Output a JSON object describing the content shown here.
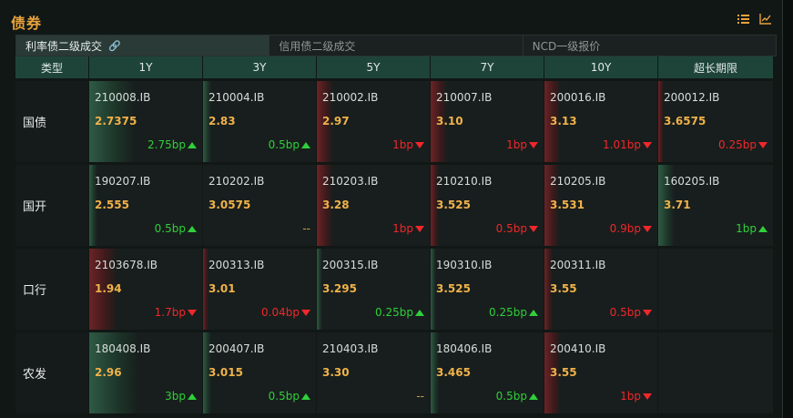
{
  "panel": {
    "title": "债券"
  },
  "tabs": [
    {
      "label": "利率债二级成交",
      "active": true
    },
    {
      "label": "信用债二级成交",
      "active": false
    },
    {
      "label": "NCD一级报价",
      "active": false
    }
  ],
  "table": {
    "corner": "类型",
    "columns": [
      "1Y",
      "3Y",
      "5Y",
      "7Y",
      "10Y",
      "超长期限"
    ],
    "rows": [
      {
        "label": "国债",
        "cells": [
          {
            "code": "210008.IB",
            "yield": "2.7375",
            "change": "2.75bp",
            "direction": "up",
            "intensity": 0.55
          },
          {
            "code": "210004.IB",
            "yield": "2.83",
            "change": "0.5bp",
            "direction": "up",
            "intensity": 0.1
          },
          {
            "code": "210002.IB",
            "yield": "2.97",
            "change": "1bp",
            "direction": "down",
            "intensity": 0.2
          },
          {
            "code": "210007.IB",
            "yield": "3.10",
            "change": "1bp",
            "direction": "down",
            "intensity": 0.2
          },
          {
            "code": "200016.IB",
            "yield": "3.13",
            "change": "1.01bp",
            "direction": "down",
            "intensity": 0.2
          },
          {
            "code": "200012.IB",
            "yield": "3.6575",
            "change": "0.25bp",
            "direction": "down",
            "intensity": 0.05
          }
        ]
      },
      {
        "label": "国开",
        "cells": [
          {
            "code": "190207.IB",
            "yield": "2.555",
            "change": "0.5bp",
            "direction": "up",
            "intensity": 0.1
          },
          {
            "code": "210202.IB",
            "yield": "3.0575",
            "change": "--",
            "direction": "flat",
            "intensity": 0
          },
          {
            "code": "210203.IB",
            "yield": "3.28",
            "change": "1bp",
            "direction": "down",
            "intensity": 0.2
          },
          {
            "code": "210210.IB",
            "yield": "3.525",
            "change": "0.5bp",
            "direction": "down",
            "intensity": 0.1
          },
          {
            "code": "210205.IB",
            "yield": "3.531",
            "change": "0.9bp",
            "direction": "down",
            "intensity": 0.18
          },
          {
            "code": "160205.IB",
            "yield": "3.71",
            "change": "1bp",
            "direction": "up",
            "intensity": 0.2
          }
        ]
      },
      {
        "label": "口行",
        "cells": [
          {
            "code": "2103678.IB",
            "yield": "1.94",
            "change": "1.7bp",
            "direction": "down",
            "intensity": 0.34
          },
          {
            "code": "200313.IB",
            "yield": "3.01",
            "change": "0.04bp",
            "direction": "down",
            "intensity": 0.01
          },
          {
            "code": "200315.IB",
            "yield": "3.295",
            "change": "0.25bp",
            "direction": "up",
            "intensity": 0.05
          },
          {
            "code": "190310.IB",
            "yield": "3.525",
            "change": "0.25bp",
            "direction": "up",
            "intensity": 0.05
          },
          {
            "code": "200311.IB",
            "yield": "3.55",
            "change": "0.5bp",
            "direction": "down",
            "intensity": 0.1
          },
          null
        ]
      },
      {
        "label": "农发",
        "cells": [
          {
            "code": "180408.IB",
            "yield": "2.96",
            "change": "3bp",
            "direction": "up",
            "intensity": 0.6
          },
          {
            "code": "200407.IB",
            "yield": "3.015",
            "change": "0.5bp",
            "direction": "up",
            "intensity": 0.1
          },
          {
            "code": "210403.IB",
            "yield": "3.30",
            "change": "--",
            "direction": "flat",
            "intensity": 0
          },
          {
            "code": "180406.IB",
            "yield": "3.465",
            "change": "0.5bp",
            "direction": "up",
            "intensity": 0.1
          },
          {
            "code": "200410.IB",
            "yield": "3.55",
            "change": "1bp",
            "direction": "down",
            "intensity": 0.2
          },
          null
        ]
      }
    ]
  },
  "toolbar": {
    "icons": [
      "list-icon",
      "line-chart-icon"
    ]
  },
  "colors": {
    "accent": "#e8a33c",
    "header_bg": "#1e4439",
    "up": "#2fd03a",
    "down": "#f0272b",
    "yield": "#f0b24a"
  }
}
